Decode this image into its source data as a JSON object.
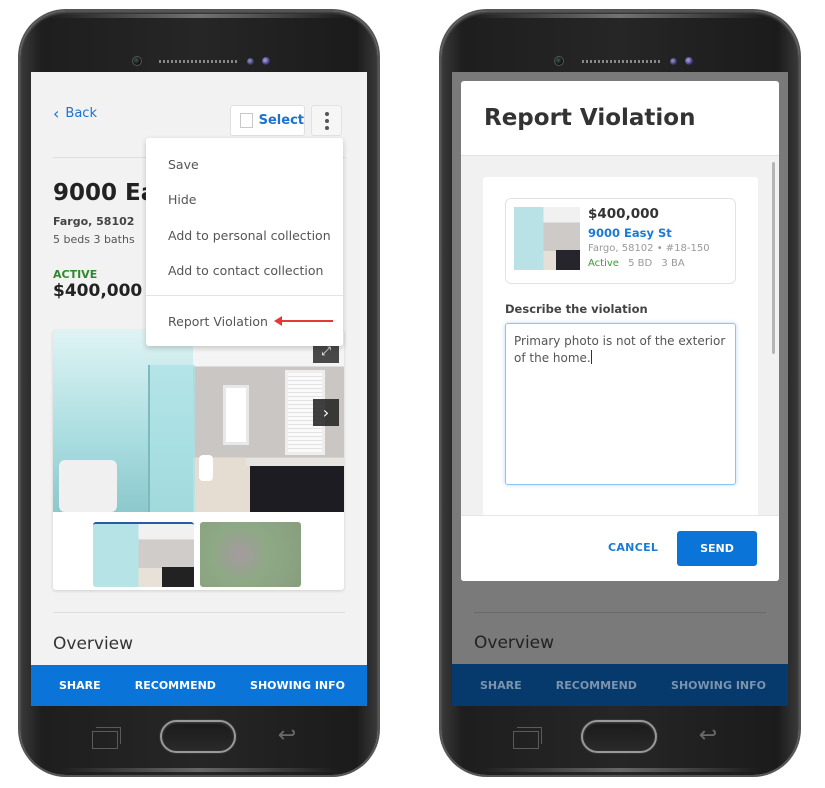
{
  "left_phone": {
    "header": {
      "back_label": "Back",
      "back_icon": "chevron-left-icon",
      "select_label": "Select",
      "more_icon": "more-vertical-icon"
    },
    "listing": {
      "address_truncated": "9000 Easy St",
      "city_zip": "Fargo, 58102",
      "beds_baths": "5 beds   3 baths",
      "status": "ACTIVE",
      "price": "$400,000"
    },
    "gallery": {
      "expand_icon": "expand-icon",
      "next_icon": "chevron-right-icon",
      "thumbnails": [
        "bathroom-photo",
        "yard-photo"
      ]
    },
    "dropdown_menu": {
      "items": [
        "Save",
        "Hide",
        "Add to personal collection",
        "Add to contact collection",
        "Report Violation"
      ],
      "highlighted_item": "Report Violation",
      "annotation": "red-arrow-pointing-left"
    },
    "section_title": "Overview",
    "bottom_bar": [
      "SHARE",
      "RECOMMEND",
      "SHOWING INFO"
    ]
  },
  "right_phone": {
    "modal": {
      "title": "Report Violation",
      "listing_card": {
        "price": "$400,000",
        "address": "9000 Easy St",
        "city_line": "Fargo, 58102 • #18-150",
        "status": "Active",
        "beds": "5 BD",
        "baths": "3 BA"
      },
      "field_label": "Describe the violation",
      "field_value": "Primary photo is not of the exterior of the home.",
      "cancel_label": "CANCEL",
      "send_label": "SEND"
    },
    "section_title": "Overview",
    "bottom_bar": [
      "SHARE",
      "RECOMMEND",
      "SHOWING INFO"
    ]
  },
  "colors": {
    "primary_blue": "#0b74d8",
    "link_blue": "#1a73d1",
    "active_green": "#2c8a2c",
    "annotation_red": "#e53935",
    "dimmed_bar": "#073a6c"
  }
}
